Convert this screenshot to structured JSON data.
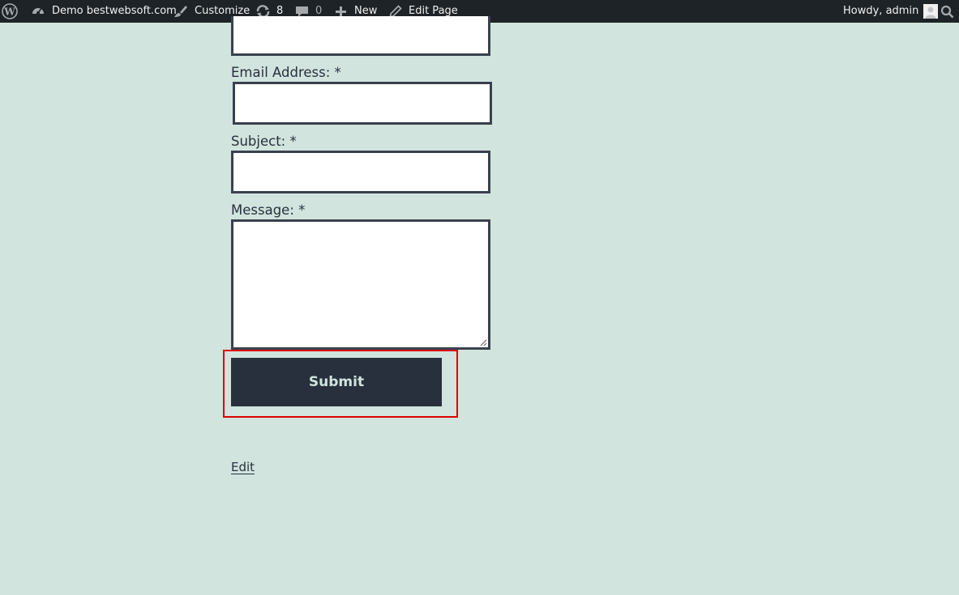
{
  "adminbar": {
    "wp_logo_icon": "wordpress-icon",
    "site_name": "Demo bestwebsoft.com",
    "customize": "Customize",
    "updates_count": "8",
    "comments_count": "0",
    "new_label": "New",
    "edit_page": "Edit Page",
    "greeting": "Howdy, admin"
  },
  "form": {
    "email_label": "Email Address: *",
    "subject_label": "Subject: *",
    "message_label": "Message: *",
    "submit_label": "Submit"
  },
  "footer": {
    "edit_link": "Edit"
  },
  "colors": {
    "background": "#d1e4dd",
    "adminbar": "#1d2327",
    "button": "#28303d",
    "highlight": "#e00000"
  }
}
